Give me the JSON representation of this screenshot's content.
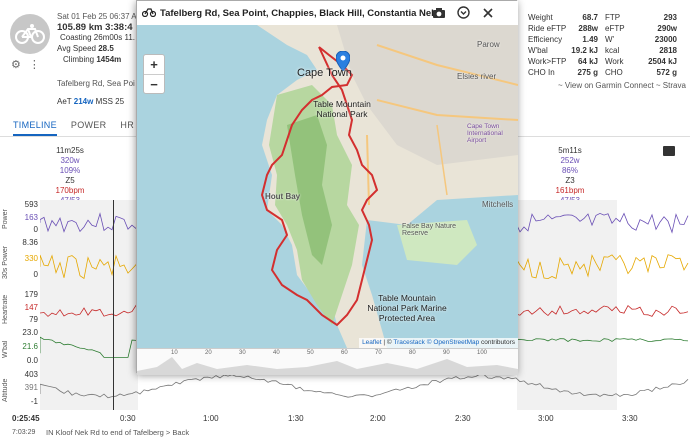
{
  "header": {
    "date": "Sat 01 Feb 25",
    "time": "06:37 AM",
    "distance": "105.89 km",
    "duration": "3:38:4",
    "coasting": "Coasting 26m00s 11.",
    "avg_speed_label": "Avg Speed",
    "avg_speed": "28.5",
    "climbing_label": "Climbing",
    "climbing": "1454m",
    "route": "Tafelberg Rd, Sea Point, ...",
    "aet_label": "AeT",
    "aet_value": "214w",
    "mss_label": "MSS",
    "mss_value": "25"
  },
  "metrics_mid": [
    {
      "label": "Weight",
      "value": "68.7"
    },
    {
      "label": "Ride eFTP",
      "value": "288w"
    },
    {
      "label": "Efficiency",
      "value": "1.49"
    },
    {
      "label": "W'bal",
      "value": "19.2 kJ"
    },
    {
      "label": "Work>FTP",
      "value": "64 kJ"
    },
    {
      "label": "CHO In",
      "value": "275 g"
    }
  ],
  "metrics_right": [
    {
      "label": "FTP",
      "value": "293"
    },
    {
      "label": "eFTP",
      "value": "290w"
    },
    {
      "label": "W'",
      "value": "23000"
    },
    {
      "label": "kcal",
      "value": "2818"
    },
    {
      "label": "Work",
      "value": "2504 kJ"
    },
    {
      "label": "CHO",
      "value": "572 g"
    }
  ],
  "links": {
    "garmin": "~ View on Garmin Connect ~ Strava"
  },
  "tabs": [
    "TIMELINE",
    "POWER",
    "HR"
  ],
  "lap_left": {
    "duration": "11m25s",
    "power": "320w",
    "pct": "109%",
    "zone": "Z5",
    "hr": "170bpm",
    "ratio": "47/53"
  },
  "lap_right": {
    "duration": "5m11s",
    "power": "252w",
    "pct": "86%",
    "zone": "Z3",
    "hr": "161bpm",
    "ratio": "47/53"
  },
  "lanes": [
    {
      "name": "Power",
      "values": [
        "593",
        "163",
        "0"
      ]
    },
    {
      "name": "30s Power",
      "values": [
        "8.36",
        "330",
        "0"
      ]
    },
    {
      "name": "Heartrate",
      "values": [
        "179",
        "147",
        "79"
      ]
    },
    {
      "name": "W'bal",
      "values": [
        "23.0",
        "21.6",
        "0.0"
      ]
    },
    {
      "name": "Altitude",
      "values": [
        "403",
        "391",
        "-1"
      ]
    }
  ],
  "x_axis": [
    "0:30",
    "1:00",
    "1:30",
    "2:00",
    "2:30",
    "3:00",
    "3:30"
  ],
  "cursor": {
    "time": "0:25:45",
    "elapsed": "7:03:29"
  },
  "footer_segment": "IN  Kloof Nek Rd to end of Tafelberg > Back",
  "popup": {
    "title": "Tafelberg Rd, Sea Point, Chappies, Black Hill, Constantia Nek",
    "zoom_in": "+",
    "zoom_out": "−",
    "credits_leaflet": "Leaflet",
    "credits_sep": " | © ",
    "credits_tracestack": "Tracestack",
    "credits_osm": "© OpenStreetMap",
    "credits_tail": " contributors",
    "place_capetown": "Cape Town",
    "place_tmnp": "Table Mountain National Park",
    "place_houtbay": "Hout Bay",
    "place_parow": "Parow",
    "place_elsies": "Elsies river",
    "place_mitchells": "Mitchells",
    "place_falsebay": "False Bay Nature Reserve",
    "place_airport": "Cape Town International Airport",
    "place_marine": "Table Mountain National Park Marine Protected Area",
    "elev_ticks": [
      "10",
      "20",
      "30",
      "40",
      "50",
      "60",
      "70",
      "80",
      "90",
      "100"
    ]
  },
  "colors": {
    "accent": "#1565c0",
    "route": "#d32f2f",
    "power": "#6a4fb5",
    "hr": "#c62828",
    "wbal": "#2e7d32"
  }
}
